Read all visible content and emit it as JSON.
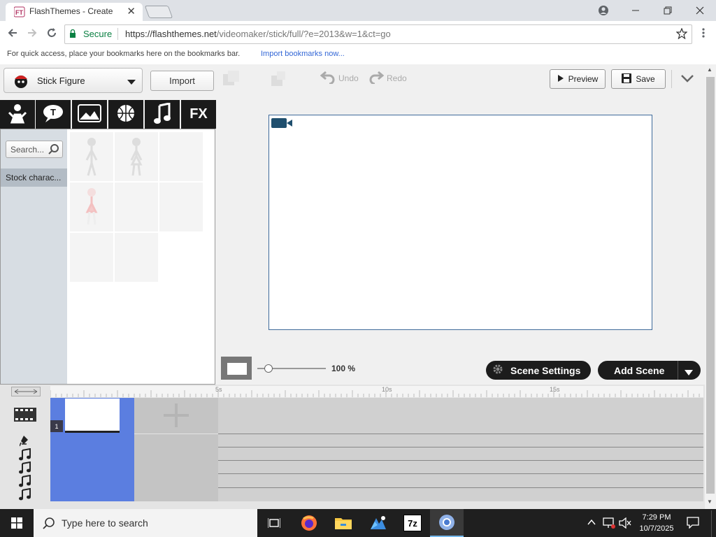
{
  "browser": {
    "tab_title": "FlashThemes - Create",
    "secure_label": "Secure",
    "url_host": "https://flashthemes.net",
    "url_path": "/videomaker/stick/full/?e=2013&w=1&ct=go",
    "bookmarks_hint": "For quick access, place your bookmarks here on the bookmarks bar.",
    "import_bookmarks_link": "Import bookmarks now..."
  },
  "app": {
    "theme_label": "Stick Figure",
    "import_label": "Import",
    "undo_label": "Undo",
    "redo_label": "Redo",
    "preview_label": "Preview",
    "save_label": "Save",
    "search_placeholder": "Search...",
    "stock_label": "Stock charac...",
    "category_tabs": [
      "character",
      "text",
      "background",
      "prop",
      "sound",
      "FX"
    ],
    "fx_label": "FX",
    "zoom_label": "100 %",
    "scene_settings_label": "Scene Settings",
    "add_scene_label": "Add Scene",
    "ruler_labels": [
      "5s",
      "10s",
      "15s"
    ],
    "scene_number": "1"
  },
  "taskbar": {
    "search_placeholder": "Type here to search",
    "time": "7:29 PM",
    "date": "10/7/2025",
    "sevenzip_label": "7z"
  },
  "colors": {
    "accent_blue": "#4d6fd6",
    "stage_border": "#3e6a9a",
    "secure_green": "#0b8043"
  }
}
